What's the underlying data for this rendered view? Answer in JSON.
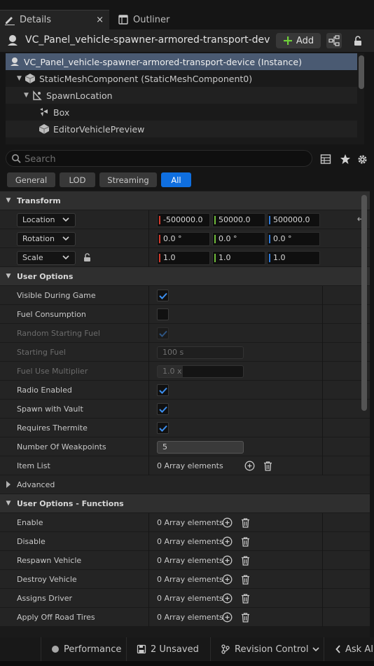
{
  "tabs": {
    "details": "Details",
    "outliner": "Outliner",
    "close_glyph": "×"
  },
  "header": {
    "actor_name": "VC_Panel_vehicle-spawner-armored-transport-dev",
    "add_label": "Add"
  },
  "tree": {
    "items": [
      {
        "label": "VC_Panel_vehicle-spawner-armored-transport-device (Instance)",
        "icon": "actor-icon"
      },
      {
        "label": "StaticMeshComponent (StaticMeshComponent0)",
        "icon": "static-mesh-icon"
      },
      {
        "label": "SpawnLocation",
        "icon": "scene-component-icon"
      },
      {
        "label": "Box",
        "icon": "box-collision-icon"
      },
      {
        "label": "EditorVehiclePreview",
        "icon": "static-mesh-icon"
      }
    ]
  },
  "search": {
    "placeholder": "Search"
  },
  "filters": [
    "General",
    "LOD",
    "Streaming",
    "All"
  ],
  "transform": {
    "category": "Transform",
    "location": {
      "label": "Location",
      "x": "-500000.0",
      "y": "50000.0",
      "z": "500000.0"
    },
    "rotation": {
      "label": "Rotation",
      "x": "0.0 °",
      "y": "0.0 °",
      "z": "0.0 °"
    },
    "scale": {
      "label": "Scale",
      "x": "1.0",
      "y": "1.0",
      "z": "1.0"
    }
  },
  "user_options": {
    "category": "User Options",
    "visible_during_game": "Visible During Game",
    "fuel_consumption": "Fuel Consumption",
    "random_starting_fuel": "Random Starting Fuel",
    "starting_fuel": {
      "label": "Starting Fuel",
      "value": "100 s"
    },
    "fuel_use_multiplier": {
      "label": "Fuel Use Multiplier",
      "value": "1.0 x"
    },
    "radio_enabled": "Radio Enabled",
    "spawn_with_vault": "Spawn with Vault",
    "requires_thermite": "Requires Thermite",
    "number_of_weakpoints": {
      "label": "Number Of Weakpoints",
      "value": "5"
    },
    "item_list": {
      "label": "Item List",
      "value": "0 Array elements"
    }
  },
  "advanced": {
    "category": "Advanced"
  },
  "functions": {
    "category": "User Options - Functions",
    "array_text": "0 Array elements",
    "items": [
      "Enable",
      "Disable",
      "Respawn Vehicle",
      "Destroy Vehicle",
      "Assigns Driver",
      "Apply Off Road Tires"
    ]
  },
  "statusbar": {
    "performance": "Performance",
    "unsaved": "2 Unsaved",
    "revision_control": "Revision Control",
    "ask_ai": "Ask AI"
  },
  "colors": {
    "accent": "#0f6fe0",
    "x_axis": "#d33a2c",
    "y_axis": "#6fbb3a",
    "z_axis": "#2f7ad8",
    "add_plus": "#6fcf3a"
  }
}
